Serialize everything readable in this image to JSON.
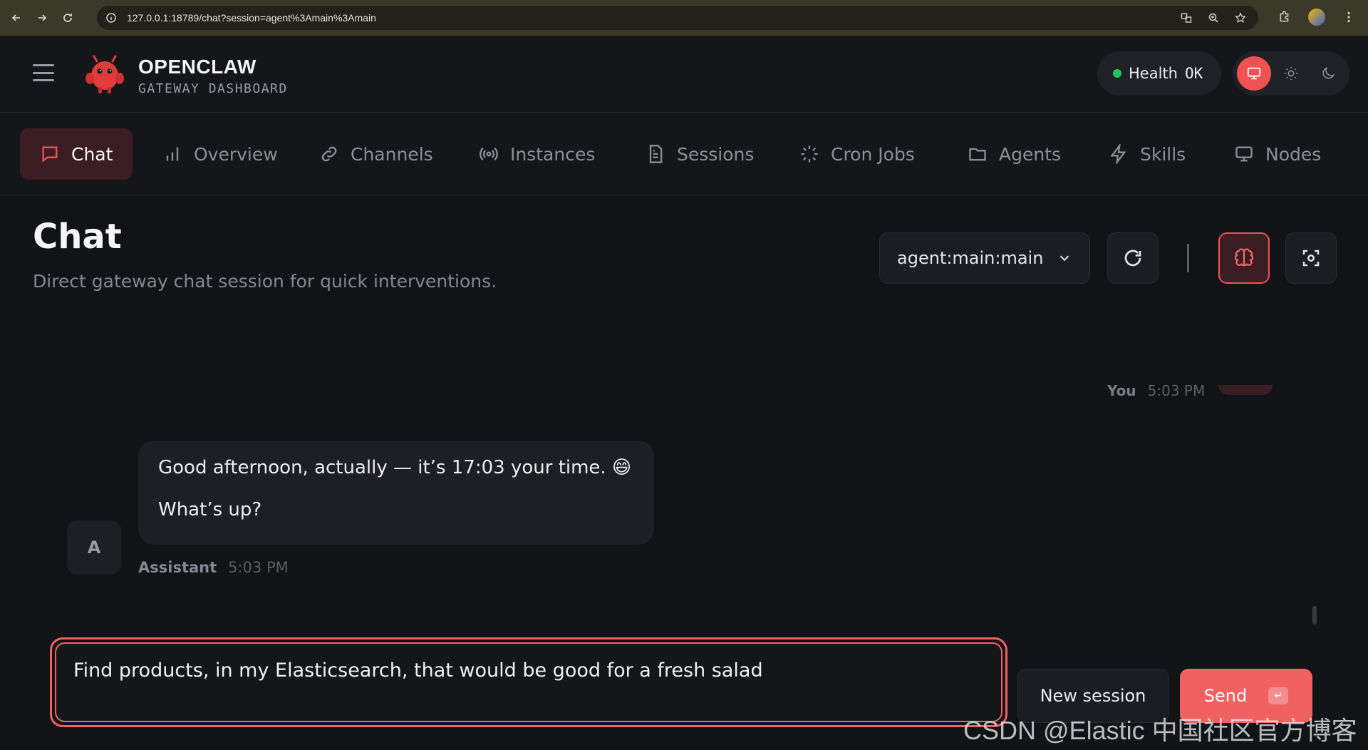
{
  "browser": {
    "url": "127.0.0.1:18789/chat?session=agent%3Amain%3Amain"
  },
  "header": {
    "brand_name": "OPENCLAW",
    "brand_sub": "GATEWAY DASHBOARD",
    "health_label": "Health",
    "health_value": "OK",
    "health_color": "#22c55e",
    "accent_color": "#f05252"
  },
  "tabs": [
    {
      "label": "Chat",
      "icon": "chat-bubble-icon",
      "active": true
    },
    {
      "label": "Overview",
      "icon": "bar-chart-icon"
    },
    {
      "label": "Channels",
      "icon": "link-icon"
    },
    {
      "label": "Instances",
      "icon": "broadcast-icon"
    },
    {
      "label": "Sessions",
      "icon": "document-icon"
    },
    {
      "label": "Cron Jobs",
      "icon": "loader-icon"
    },
    {
      "label": "Agents",
      "icon": "folder-icon"
    },
    {
      "label": "Skills",
      "icon": "lightning-icon"
    },
    {
      "label": "Nodes",
      "icon": "monitor-icon"
    }
  ],
  "main": {
    "title": "Chat",
    "subtitle": "Direct gateway chat session for quick interventions.",
    "session_value": "agent:main:main"
  },
  "messages": {
    "you": {
      "name": "You",
      "time": "5:03 PM"
    },
    "assistant": {
      "avatar": "A",
      "lines": [
        "Good afternoon, actually — it’s 17:03 your time. 😄",
        "What’s up?"
      ],
      "name": "Assistant",
      "time": "5:03 PM"
    }
  },
  "composer": {
    "value": "Find products, in my Elasticsearch, that would be good for a fresh salad",
    "new_session_label": "New session",
    "send_label": "Send",
    "send_kbd": "↵"
  },
  "watermark": "CSDN @Elastic 中国社区官方博客"
}
